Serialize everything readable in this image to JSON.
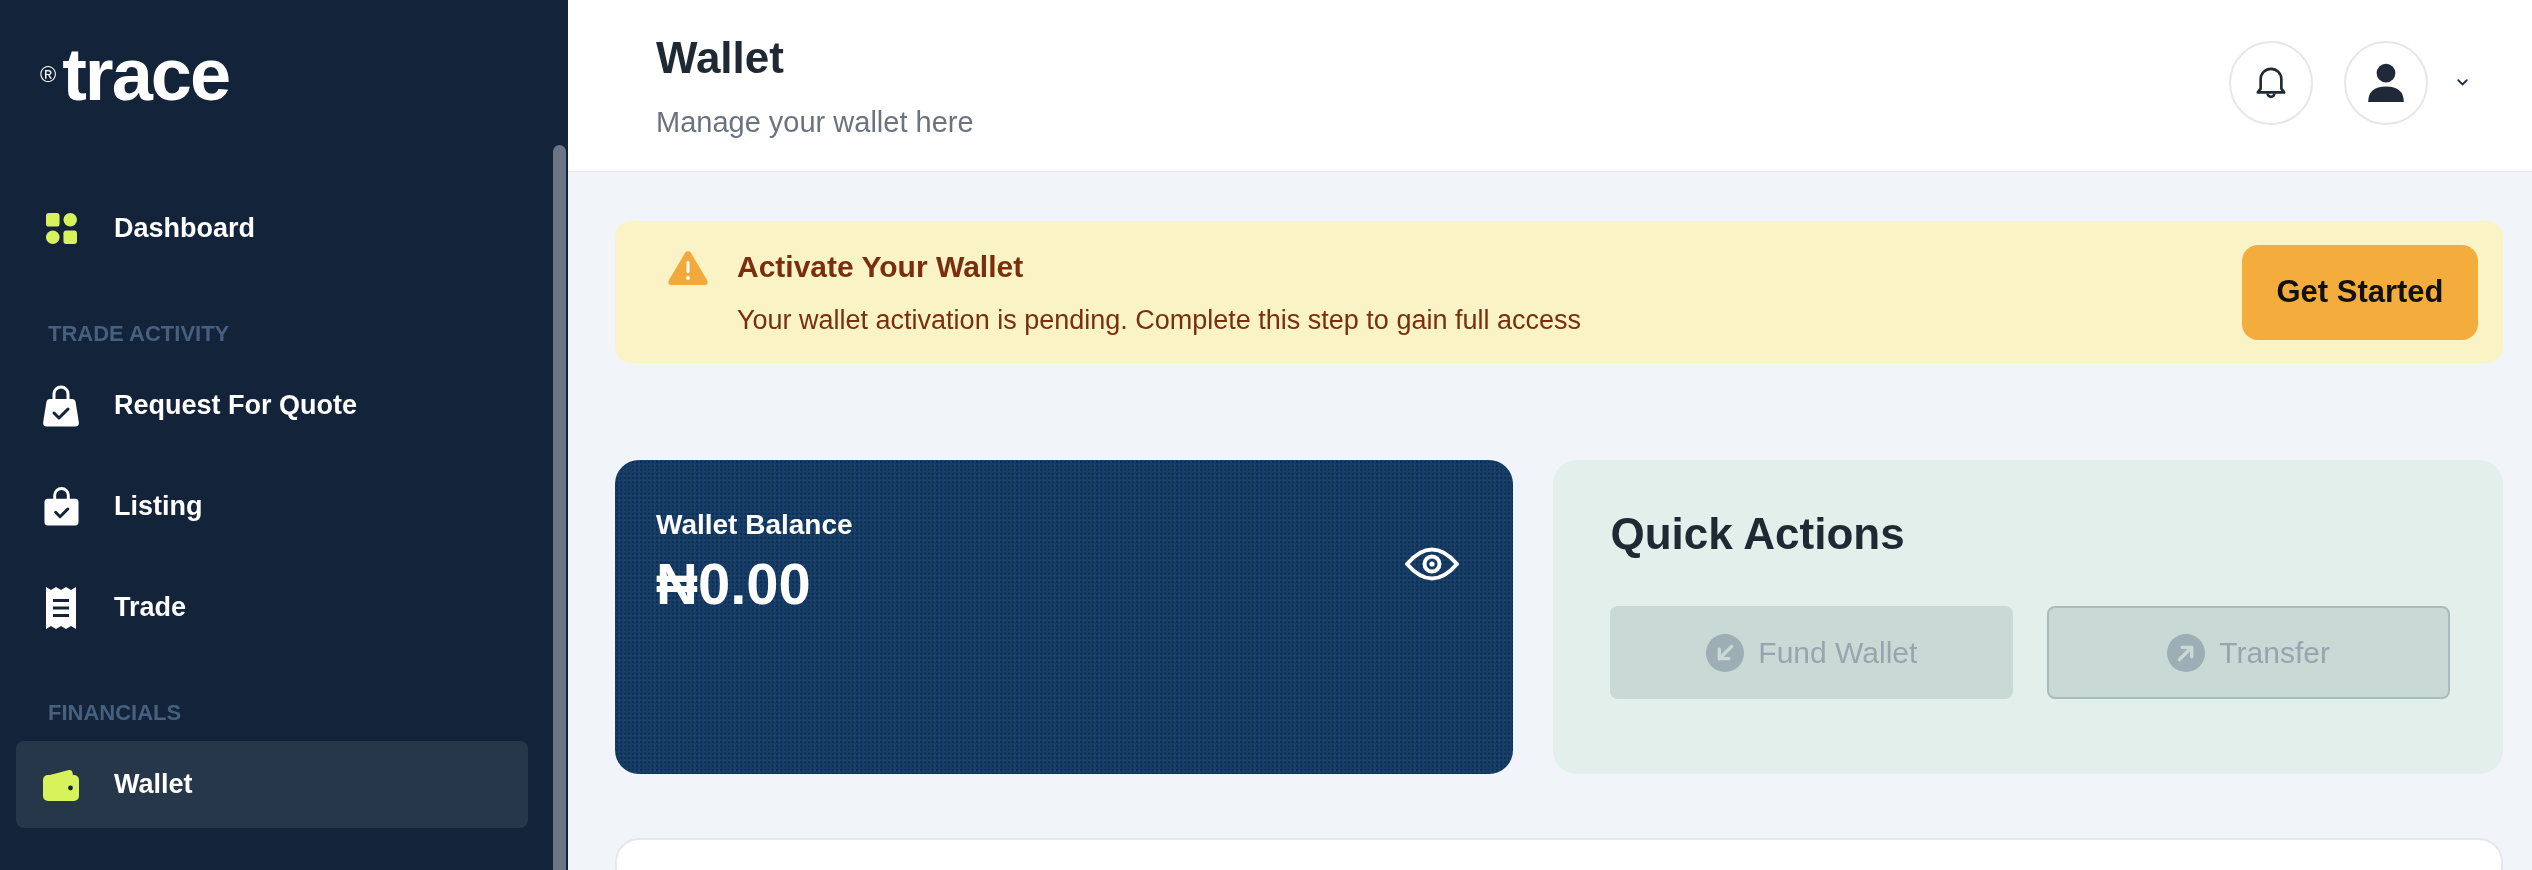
{
  "sidebar": {
    "logo": {
      "mark": "®",
      "wordmark": "trace"
    },
    "groups": [
      {
        "items": [
          {
            "label": "Dashboard",
            "selected": false
          }
        ]
      },
      {
        "heading": "TRADE ACTIVITY",
        "items": [
          {
            "label": "Request For Quote",
            "selected": false
          },
          {
            "label": "Listing",
            "selected": false
          },
          {
            "label": "Trade",
            "selected": false
          }
        ]
      },
      {
        "heading": "FINANCIALS",
        "items": [
          {
            "label": "Wallet",
            "selected": true
          }
        ]
      }
    ]
  },
  "header": {
    "title": "Wallet",
    "subtitle": "Manage your wallet here"
  },
  "banner": {
    "title": "Activate Your Wallet",
    "message": "Your wallet activation is pending. Complete this step to gain full access",
    "button": "Get Started"
  },
  "balance_card": {
    "label": "Wallet Balance",
    "amount": "₦0.00"
  },
  "quick_actions": {
    "title": "Quick Actions",
    "actions": [
      {
        "label": "Fund Wallet",
        "kind": "incoming",
        "disabled": true,
        "focused": false
      },
      {
        "label": "Transfer",
        "kind": "outgoing",
        "disabled": true,
        "focused": true
      }
    ]
  }
}
